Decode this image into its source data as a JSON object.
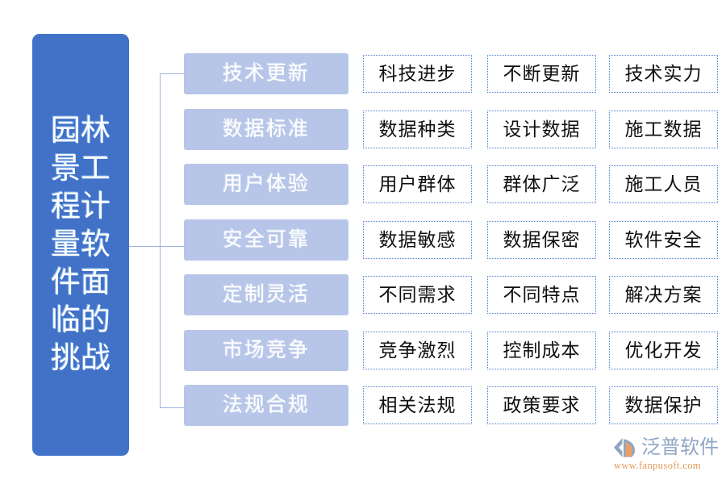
{
  "title": {
    "text": "园林景工程计量软件面临的挑战",
    "color": "#4272c8",
    "text_color": "#ffffff"
  },
  "colors": {
    "primary_blue": "#4272c8",
    "category_fill": "#b7c6e8",
    "leaf_border": "#4a7fd0",
    "connector": "#9ab4dd",
    "glow": "#baf0eb",
    "logo_blue": "#8fa5c4",
    "logo_orange": "#e09a5c"
  },
  "rows": [
    {
      "category": "技术更新",
      "leaves": [
        "科技进步",
        "不断更新",
        "技术实力"
      ]
    },
    {
      "category": "数据标准",
      "leaves": [
        "数据种类",
        "设计数据",
        "施工数据"
      ]
    },
    {
      "category": "用户体验",
      "leaves": [
        "用户群体",
        "群体广泛",
        "施工人员"
      ]
    },
    {
      "category": "安全可靠",
      "leaves": [
        "数据敏感",
        "数据保密",
        "软件安全"
      ]
    },
    {
      "category": "定制灵活",
      "leaves": [
        "不同需求",
        "不同特点",
        "解决方案"
      ]
    },
    {
      "category": "市场竞争",
      "leaves": [
        "竞争激烈",
        "控制成本",
        "优化开发"
      ]
    },
    {
      "category": "法规合规",
      "leaves": [
        "相关法规",
        "政策要求",
        "数据保护"
      ]
    }
  ],
  "watermark": {
    "text": "泛普软件",
    "url": "www.fanpusoft.com"
  },
  "logo": {
    "name": "泛普软件",
    "url": "www.fanpusoft.com"
  }
}
